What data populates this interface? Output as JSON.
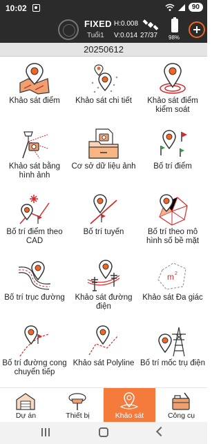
{
  "status_bar": {
    "time": "10:02",
    "battery": "90"
  },
  "gnss": {
    "solution": "FIXED",
    "age": "Tuổi1",
    "hrms": "H:0.008",
    "vrms": "V:0.014",
    "satellites": "27/37",
    "receiver_battery": "98%"
  },
  "project_name": "20250612",
  "menu": [
    {
      "label": "Khảo sát điểm",
      "icon": "point-survey-icon"
    },
    {
      "label": "Khảo sát chi tiết",
      "icon": "detail-survey-icon"
    },
    {
      "label": "Khảo sát điểm kiểm soát",
      "icon": "control-point-icon"
    },
    {
      "label": "Khảo sát bằng hình ảnh",
      "icon": "image-survey-icon"
    },
    {
      "label": "Cơ sở dữ liệu ảnh",
      "icon": "photo-database-icon"
    },
    {
      "label": "Bố trí điểm",
      "icon": "stakeout-point-icon"
    },
    {
      "label": "Bố trí điểm theo CAD",
      "icon": "cad-stakeout-icon"
    },
    {
      "label": "Bố trí tuyến",
      "icon": "line-stakeout-icon"
    },
    {
      "label": "Bố trí theo mô hình số bề mặt",
      "icon": "surface-model-icon"
    },
    {
      "label": "Bố trí trục đường",
      "icon": "road-stakeout-icon"
    },
    {
      "label": "Khảo sát đường điện",
      "icon": "powerline-survey-icon"
    },
    {
      "label": "Khảo sát Đa giác",
      "icon": "polygon-area-icon"
    },
    {
      "label": "Bố trí đường cong chuyển tiếp",
      "icon": "transition-curve-icon"
    },
    {
      "label": "Khảo sát Polyline",
      "icon": "polyline-survey-icon"
    },
    {
      "label": "Bố trí mốc trụ điện",
      "icon": "tower-stakeout-icon"
    }
  ],
  "tabs": [
    {
      "label": "Dự án",
      "icon": "warehouse-icon",
      "active": false
    },
    {
      "label": "Thiết bị",
      "icon": "gnss-receiver-icon",
      "active": false
    },
    {
      "label": "Khảo sát",
      "icon": "survey-pin-icon",
      "active": true
    },
    {
      "label": "Công cụ",
      "icon": "toolbox-icon",
      "active": false
    }
  ],
  "colors": {
    "accent": "#f47b3c",
    "header_bg": "#2b2b2b",
    "pin_orange": "#f26522",
    "stake_red": "#d9262a"
  }
}
